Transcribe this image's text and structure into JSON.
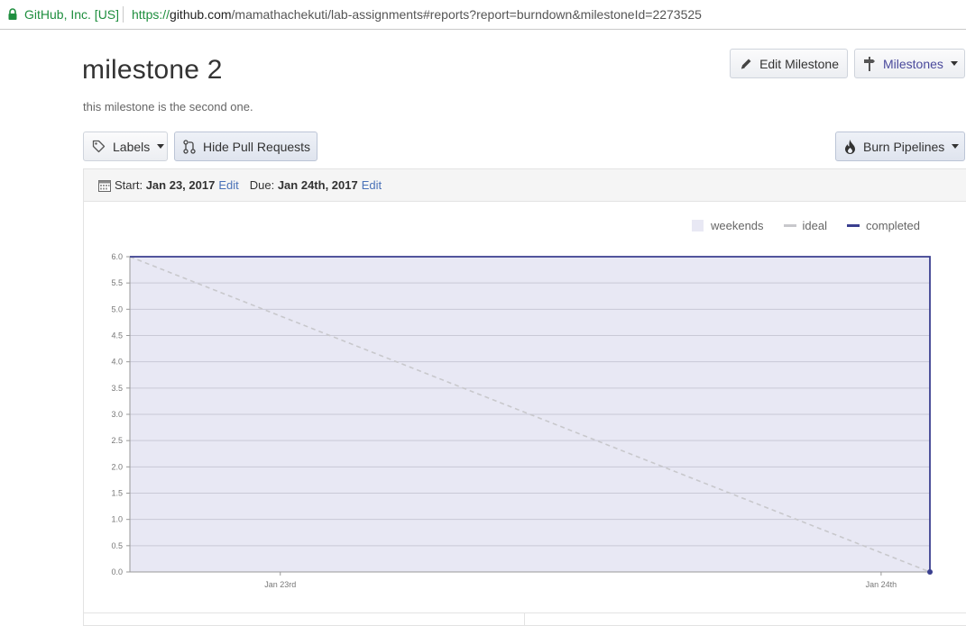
{
  "browser": {
    "site_identity": "GitHub, Inc. [US]",
    "url_scheme": "https://",
    "url_host": "github.com",
    "url_path": "/mamathachekuti/lab-assignments#reports?report=burndown&milestoneId=2273525",
    "secure_color": "#1e8e3e"
  },
  "milestone": {
    "title": "milestone 2",
    "description": "this milestone is the second one."
  },
  "toolbar": {
    "edit_milestone": "Edit Milestone",
    "milestones": "Milestones",
    "labels": "Labels",
    "hide_pull_requests": "Hide Pull Requests",
    "burn_pipelines": "Burn Pipelines"
  },
  "dates": {
    "start_label": "Start:",
    "start_value": "Jan 23, 2017",
    "start_edit": "Edit",
    "due_label": "Due:",
    "due_value": "Jan 24th, 2017",
    "due_edit": "Edit"
  },
  "colors": {
    "weekends": "#e8e8f4",
    "ideal": "#c8c8cc",
    "completed": "#3a3f8f",
    "link": "#4a72b8"
  },
  "chart_data": {
    "type": "line",
    "title": "",
    "xlabel": "",
    "ylabel": "",
    "legend": [
      "weekends",
      "ideal",
      "completed"
    ],
    "legend_position": "top-right",
    "ylim": [
      0,
      6
    ],
    "yticks": [
      "0.0",
      "0.5",
      "1.0",
      "1.5",
      "2.0",
      "2.5",
      "3.0",
      "3.5",
      "4.0",
      "4.5",
      "5.0",
      "5.5",
      "6.0"
    ],
    "x_ticks": [
      "Jan 23rd",
      "Jan 24th"
    ],
    "grid": true,
    "series": [
      {
        "name": "ideal",
        "style": "dashed",
        "points": [
          [
            "Jan 22nd end",
            6.0
          ],
          [
            "Jan 24th end",
            0.0
          ]
        ]
      },
      {
        "name": "completed",
        "style": "solid",
        "points": [
          [
            "Jan 22nd end",
            6.0
          ],
          [
            "Jan 24th end",
            6.0
          ],
          [
            "Jan 24th end",
            0.0
          ]
        ]
      }
    ],
    "weekends_shaded": true
  }
}
